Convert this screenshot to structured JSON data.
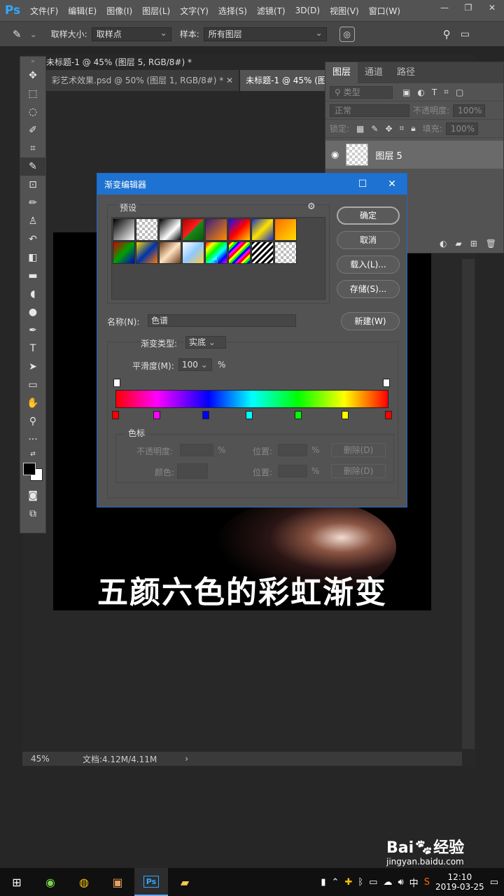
{
  "menubar": {
    "logo": "Ps",
    "items": [
      "文件(F)",
      "编辑(E)",
      "图像(I)",
      "图层(L)",
      "文字(Y)",
      "选择(S)",
      "滤镜(T)",
      "3D(D)",
      "视图(V)",
      "窗口(W)"
    ],
    "window_controls": [
      "—",
      "❐",
      "✕"
    ]
  },
  "options": {
    "sample_size_label": "取样大小:",
    "sample_size_value": "取样点",
    "sample_label": "样本:",
    "sample_value": "所有图层"
  },
  "document": {
    "title_strip": "未标题-1 @ 45% (图层 5, RGB/8#) *",
    "tabs": [
      "彩艺术效果.psd @ 50% (图层 1, RGB/8#) *",
      "未标题-1 @ 45% (图"
    ],
    "caption": "五颜六色的彩虹渐变",
    "zoom": "45%",
    "doc_size": "文档:4.12M/4.11M"
  },
  "layers_panel": {
    "tabs": [
      "图层",
      "通道",
      "路径"
    ],
    "kind_placeholder": "类型",
    "blend_mode": "正常",
    "opacity_label": "不透明度:",
    "opacity_value": "100%",
    "lock_label": "锁定:",
    "fill_label": "填充:",
    "fill_value": "100%",
    "layer_name": "图层 5"
  },
  "gradient_editor": {
    "title": "渐变编辑器",
    "presets_label": "预设",
    "buttons": {
      "ok": "确定",
      "cancel": "取消",
      "load": "载入(L)...",
      "save": "存储(S)...",
      "new": "新建(W)"
    },
    "name_label": "名称(N):",
    "name_value": "色谱",
    "gradient_type_label": "渐变类型:",
    "gradient_type_value": "实底",
    "smoothness_label": "平滑度(M):",
    "smoothness_value": "100",
    "percent": "%",
    "stops_label": "色标",
    "opacity_label": "不透明度:",
    "color_label": "颜色:",
    "location_label": "位置:",
    "delete_label": "删除(D)",
    "color_stops": [
      {
        "color": "#ff0000",
        "location": 0
      },
      {
        "color": "#ff00ff",
        "location": 15
      },
      {
        "color": "#0000ff",
        "location": 33
      },
      {
        "color": "#00ffff",
        "location": 49
      },
      {
        "color": "#00ff00",
        "location": 67
      },
      {
        "color": "#ffff00",
        "location": 84
      },
      {
        "color": "#ff0000",
        "location": 100
      }
    ]
  },
  "taskbar": {
    "time": "12:10",
    "date": "2019-03-25",
    "ime": "中",
    "ps_label": "Ps"
  },
  "watermark": {
    "brand": "Bai",
    "brand2": "经验",
    "url": "jingyan.baidu.com"
  },
  "colors": {
    "accent": "#1e72d2",
    "ps_blue": "#31a8ff"
  }
}
